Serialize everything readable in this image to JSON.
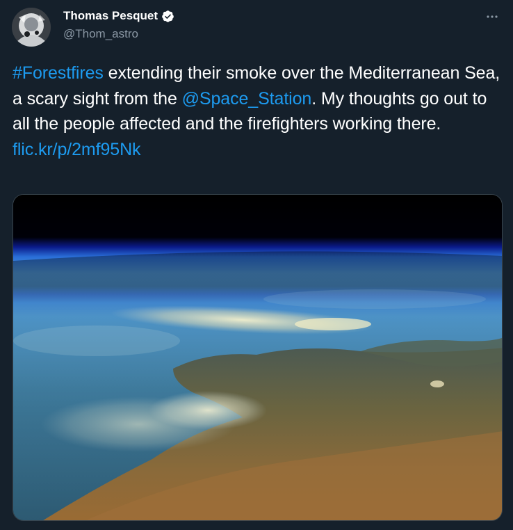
{
  "author": {
    "display_name": "Thomas Pesquet",
    "handle": "@Thom_astro",
    "verified": true
  },
  "tweet": {
    "hashtag": "#Forestfires",
    "text_part1": " extending their smoke over the Mediterranean Sea, a scary sight from the ",
    "mention": "@Space_Station",
    "text_part2": ". My thoughts go out to all the people affected and the firefighters working there.",
    "link": "flic.kr/p/2mf95Nk"
  },
  "icons": {
    "verified": "verified-badge-icon",
    "more": "more-options-icon"
  },
  "colors": {
    "background": "#15202b",
    "link": "#1d9bf0",
    "secondary_text": "#8b98a5"
  }
}
